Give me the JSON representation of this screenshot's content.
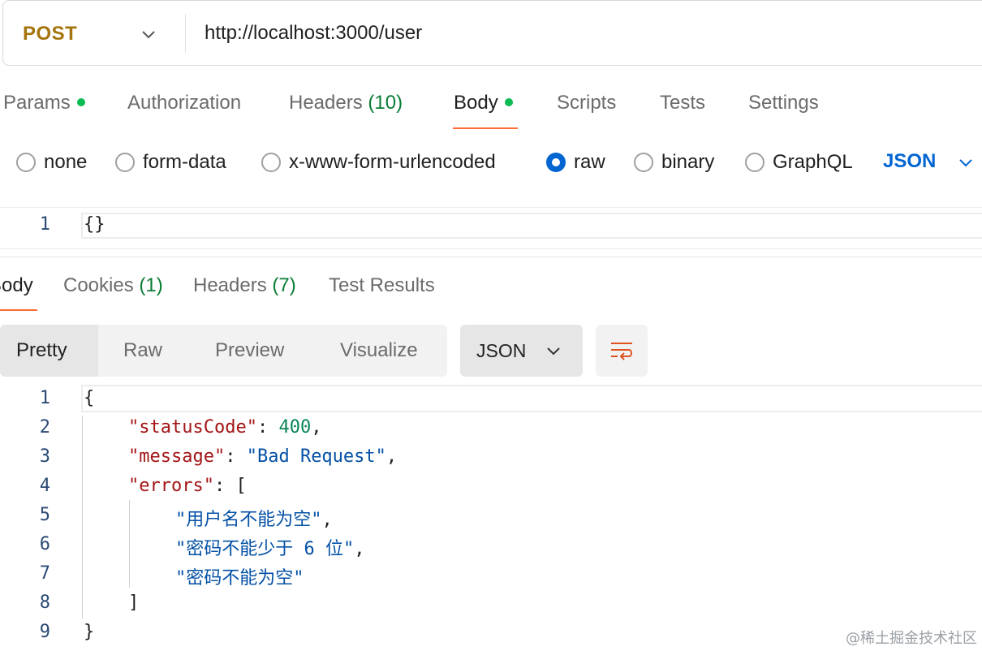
{
  "request": {
    "method": "POST",
    "url": "http://localhost:3000/user"
  },
  "request_tabs": {
    "params": "Params",
    "authorization": "Authorization",
    "headers": "Headers",
    "headers_count": "(10)",
    "body": "Body",
    "scripts": "Scripts",
    "tests": "Tests",
    "settings": "Settings"
  },
  "body_types": {
    "none": "none",
    "form_data": "form-data",
    "urlencoded": "x-www-form-urlencoded",
    "raw": "raw",
    "binary": "binary",
    "graphql": "GraphQL",
    "selected": "raw",
    "format": "JSON"
  },
  "request_body": {
    "lines": [
      {
        "num": "1",
        "text": "{}"
      }
    ]
  },
  "response_tabs": {
    "body": "Body",
    "cookies": "Cookies",
    "cookies_count": "(1)",
    "headers": "Headers",
    "headers_count": "(7)",
    "test_results": "Test Results"
  },
  "response_view": {
    "pretty": "Pretty",
    "raw": "Raw",
    "preview": "Preview",
    "visualize": "Visualize",
    "format": "JSON"
  },
  "response_body": {
    "line_numbers": [
      "1",
      "2",
      "3",
      "4",
      "5",
      "6",
      "7",
      "8",
      "9"
    ],
    "open_brace": "{",
    "close_brace": "}",
    "status_key": "\"statusCode\"",
    "status_value": "400",
    "message_key": "\"message\"",
    "message_value": "\"Bad Request\"",
    "errors_key": "\"errors\"",
    "errors_open": "[",
    "errors_close": "]",
    "errors": [
      "\"用户名不能为空\"",
      "\"密码不能少于 6 位\"",
      "\"密码不能为空\""
    ]
  },
  "watermark": "@稀土掘金技术社区",
  "colors": {
    "method": "#a5740c",
    "accent_orange": "#ff6c37",
    "link_blue": "#0265d2",
    "dot_green": "#0cbb52",
    "json_key": "#a31515",
    "json_string": "#0451a5",
    "json_number": "#098658"
  }
}
